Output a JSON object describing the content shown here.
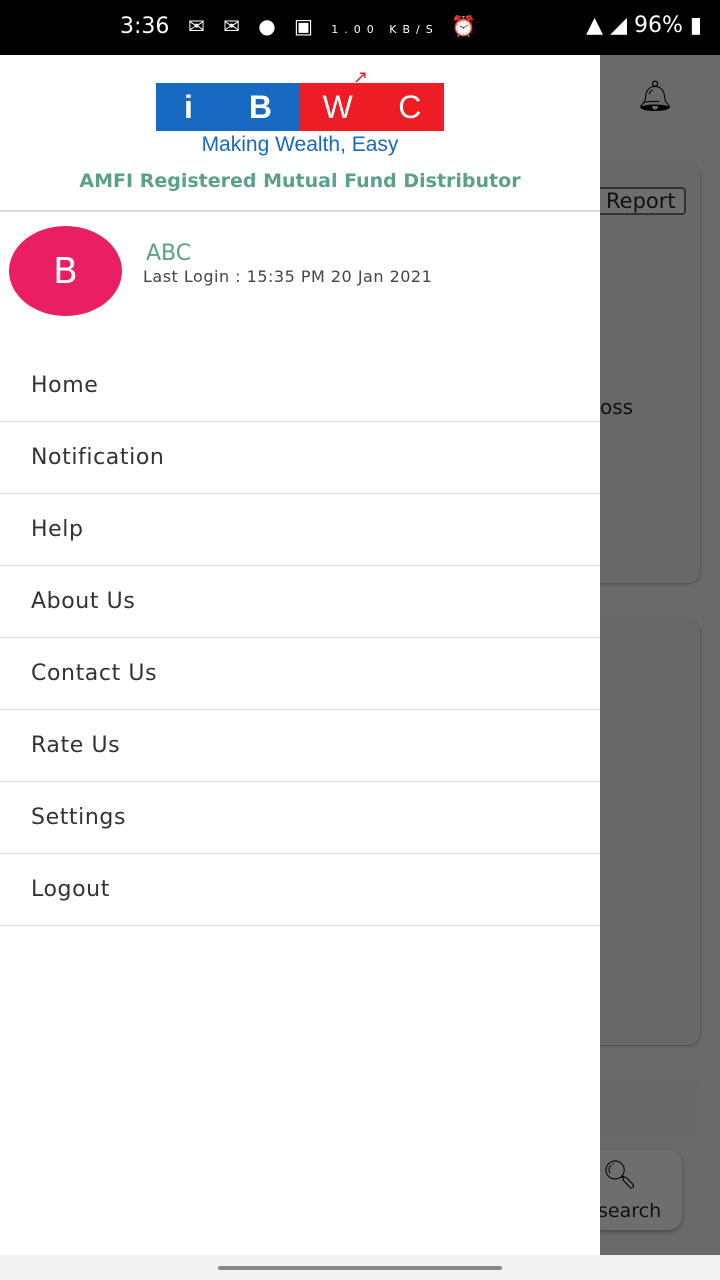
{
  "status_bar": {
    "time": "3:36",
    "icons": "messenger messenger circle image",
    "speed": "1.00 KB/S",
    "battery": "96%"
  },
  "background": {
    "report_label": "Report",
    "partial_text": "oss",
    "research_label": "search"
  },
  "drawer": {
    "logo": {
      "letters": [
        "i",
        "B",
        "W",
        "C"
      ],
      "tagline": "Making Wealth, Easy"
    },
    "subtitle": "AMFI Registered Mutual Fund Distributor",
    "user": {
      "initial": "B",
      "name": "ABC",
      "last_login": "Last Login : 15:35 PM  20 Jan 2021"
    },
    "menu": [
      {
        "label": "Home"
      },
      {
        "label": "Notification"
      },
      {
        "label": "Help"
      },
      {
        "label": "About Us"
      },
      {
        "label": "Contact Us"
      },
      {
        "label": "Rate Us"
      },
      {
        "label": "Settings"
      },
      {
        "label": "Logout"
      }
    ]
  },
  "colors": {
    "accent": "#5aa08a",
    "avatar": "#e91e63",
    "logo_blue": "#1769c2",
    "logo_red": "#ee1c24"
  }
}
